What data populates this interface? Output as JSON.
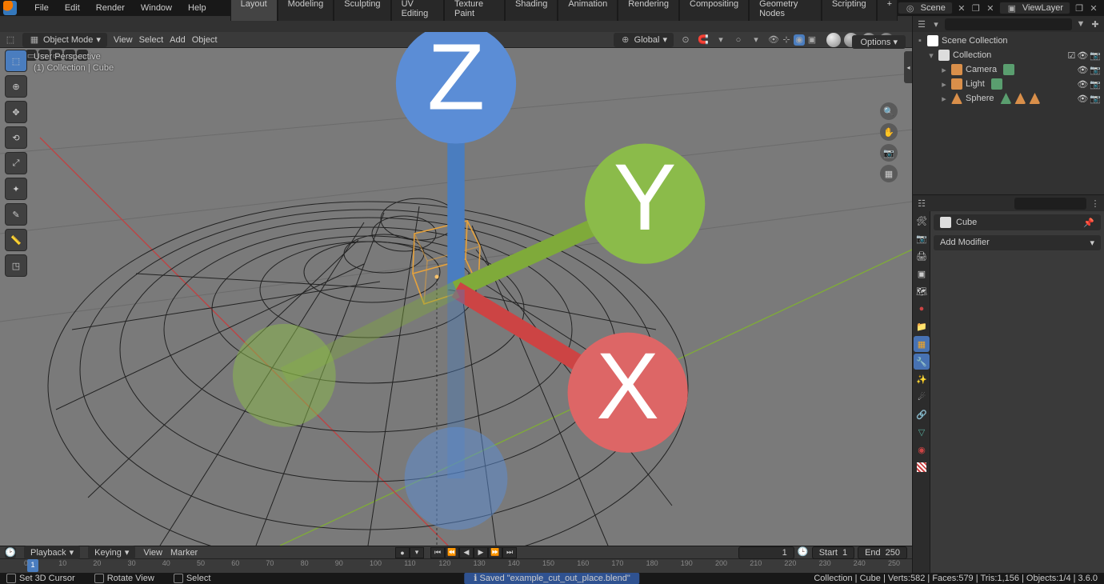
{
  "menu": [
    "File",
    "Edit",
    "Render",
    "Window",
    "Help"
  ],
  "workspace_tabs": [
    "Layout",
    "Modeling",
    "Sculpting",
    "UV Editing",
    "Texture Paint",
    "Shading",
    "Animation",
    "Rendering",
    "Compositing",
    "Geometry Nodes",
    "Scripting"
  ],
  "active_workspace": "Layout",
  "scene_field": {
    "label": "Scene",
    "value": "Scene"
  },
  "viewlayer_field": {
    "label": "ViewLayer",
    "value": "ViewLayer"
  },
  "viewport": {
    "mode": "Object Mode",
    "menus": [
      "View",
      "Select",
      "Add",
      "Object"
    ],
    "orientation": "Global",
    "overlay_text_1": "User Perspective",
    "overlay_text_2": "(1) Collection | Cube",
    "options_label": "Options"
  },
  "nav_axes": {
    "x": "X",
    "y": "Y",
    "z": "Z"
  },
  "timeline": {
    "dropdowns": [
      "Playback",
      "Keying"
    ],
    "menus": [
      "View",
      "Marker"
    ],
    "current": 1,
    "start_label": "Start",
    "start": 1,
    "end_label": "End",
    "end": 250,
    "ticks": [
      0,
      10,
      20,
      30,
      40,
      50,
      60,
      70,
      80,
      90,
      100,
      110,
      120,
      130,
      140,
      150,
      160,
      170,
      180,
      190,
      200,
      210,
      220,
      230,
      240,
      250
    ]
  },
  "outliner": {
    "root": "Scene Collection",
    "collection": "Collection",
    "items": [
      {
        "name": "Camera",
        "icon": "camera",
        "color": "#d98f4a"
      },
      {
        "name": "Light",
        "icon": "light",
        "color": "#d98f4a"
      },
      {
        "name": "Sphere",
        "icon": "mesh",
        "color": "#d98f4a"
      }
    ]
  },
  "properties": {
    "object_name": "Cube",
    "add_modifier": "Add Modifier"
  },
  "status": {
    "left": [
      {
        "icon": "cursor",
        "label": "Set 3D Cursor"
      },
      {
        "icon": "mmb",
        "label": "Rotate View"
      },
      {
        "icon": "lmb",
        "label": "Select"
      }
    ],
    "message": "Saved \"example_cut_out_place.blend\"",
    "right": "Collection | Cube | Verts:582 | Faces:579 | Tris:1,156 | Objects:1/4 | 3.6.0"
  }
}
